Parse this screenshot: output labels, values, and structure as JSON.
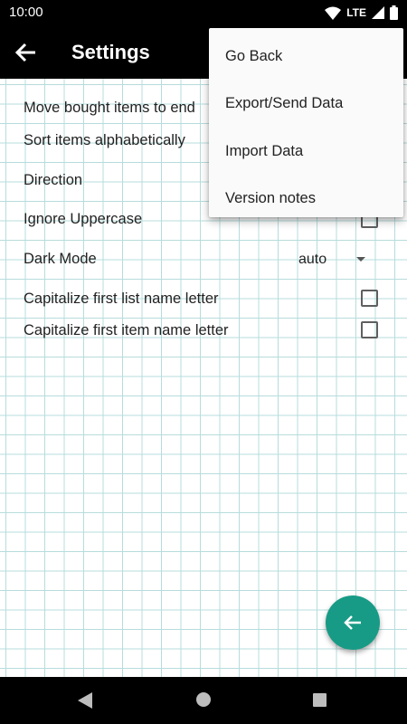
{
  "status_bar": {
    "time": "10:00",
    "network": "LTE",
    "icons": [
      "wifi-icon",
      "cellular-signal-icon",
      "battery-icon"
    ]
  },
  "app_bar": {
    "title": "Settings",
    "back_icon": "arrow-left-icon"
  },
  "settings": {
    "move_bought_items": "Move bought items to end",
    "sort_alphabetically": "Sort items alphabetically",
    "direction": "Direction",
    "ignore_uppercase": "Ignore Uppercase",
    "dark_mode": {
      "label": "Dark Mode",
      "value": "auto"
    },
    "capitalize_list_name": {
      "label": "Capitalize first list name letter",
      "checked": false
    },
    "capitalize_item_name": {
      "label": "Capitalize first item name letter",
      "checked": false
    }
  },
  "overflow_menu": {
    "items": [
      "Go Back",
      "Export/Send Data",
      "Import Data",
      "Version notes"
    ]
  },
  "fab": {
    "icon": "arrow-left-icon"
  },
  "nav_bar": {
    "icons": [
      "nav-back-icon",
      "nav-home-icon",
      "nav-recents-icon"
    ]
  },
  "colors": {
    "accent": "#179b86",
    "grid_line": "#b7dcdc",
    "app_bar": "#000000"
  }
}
